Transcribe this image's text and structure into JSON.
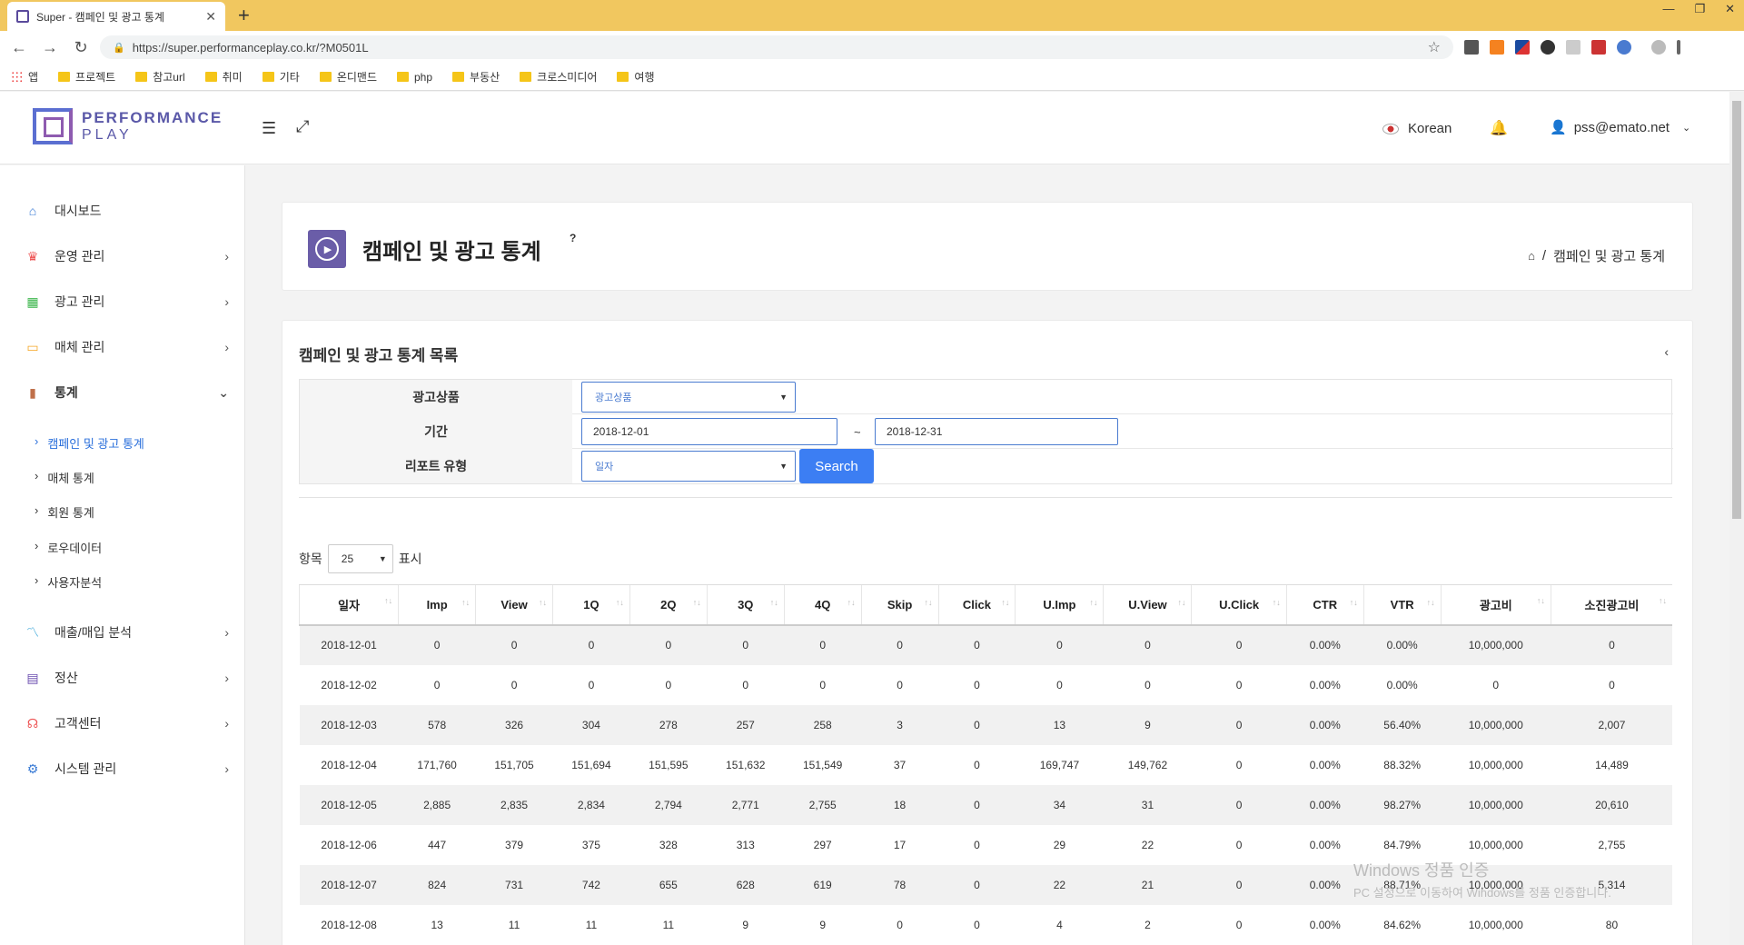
{
  "browser": {
    "tab_title": "Super - 캠페인 및 광고 통계",
    "url": "https://super.performanceplay.co.kr/?M0501L",
    "bookmarks": [
      "앱",
      "프로젝트",
      "참고url",
      "취미",
      "기타",
      "온디맨드",
      "php",
      "부동산",
      "크로스미디어",
      "여행"
    ]
  },
  "header": {
    "logo_line1": "PERFORMANCE",
    "logo_line2": "PLAY",
    "language": "Korean",
    "user_email": "pss@emato.net"
  },
  "sidebar": {
    "items": [
      {
        "label": "대시보드",
        "icon": "home-icon"
      },
      {
        "label": "운영 관리",
        "icon": "crown-icon"
      },
      {
        "label": "광고 관리",
        "icon": "grid-icon"
      },
      {
        "label": "매체 관리",
        "icon": "monitor-icon"
      },
      {
        "label": "통계",
        "icon": "bar-chart-icon"
      },
      {
        "label": "매출/매입 분석",
        "icon": "line-chart-icon"
      },
      {
        "label": "정산",
        "icon": "calculator-icon"
      },
      {
        "label": "고객센터",
        "icon": "headset-icon"
      },
      {
        "label": "시스템 관리",
        "icon": "gear-icon"
      }
    ],
    "sub_items": [
      "캠페인 및 광고 통계",
      "매체 통계",
      "회원 통계",
      "로우데이터",
      "사용자분석"
    ]
  },
  "page": {
    "title": "캠페인 및 광고 통계",
    "help": "?",
    "breadcrumb": "캠페인 및 광고 통계"
  },
  "list": {
    "title": "캠페인 및 광고 통계 목록",
    "filter": {
      "product_label": "광고상품",
      "product_value": "광고상품",
      "period_label": "기간",
      "date_from": "2018-12-01",
      "tilde": "~",
      "date_to": "2018-12-31",
      "report_label": "리포트 유형",
      "report_value": "일자",
      "search_label": "Search"
    },
    "page_length": {
      "prefix": "항목",
      "value": "25",
      "suffix": "표시"
    },
    "columns": [
      "일자",
      "Imp",
      "View",
      "1Q",
      "2Q",
      "3Q",
      "4Q",
      "Skip",
      "Click",
      "U.Imp",
      "U.View",
      "U.Click",
      "CTR",
      "VTR",
      "광고비",
      "소진광고비"
    ],
    "rows": [
      [
        "2018-12-01",
        "0",
        "0",
        "0",
        "0",
        "0",
        "0",
        "0",
        "0",
        "0",
        "0",
        "0",
        "0.00%",
        "0.00%",
        "10,000,000",
        "0"
      ],
      [
        "2018-12-02",
        "0",
        "0",
        "0",
        "0",
        "0",
        "0",
        "0",
        "0",
        "0",
        "0",
        "0",
        "0.00%",
        "0.00%",
        "0",
        "0"
      ],
      [
        "2018-12-03",
        "578",
        "326",
        "304",
        "278",
        "257",
        "258",
        "3",
        "0",
        "13",
        "9",
        "0",
        "0.00%",
        "56.40%",
        "10,000,000",
        "2,007"
      ],
      [
        "2018-12-04",
        "171,760",
        "151,705",
        "151,694",
        "151,595",
        "151,632",
        "151,549",
        "37",
        "0",
        "169,747",
        "149,762",
        "0",
        "0.00%",
        "88.32%",
        "10,000,000",
        "14,489"
      ],
      [
        "2018-12-05",
        "2,885",
        "2,835",
        "2,834",
        "2,794",
        "2,771",
        "2,755",
        "18",
        "0",
        "34",
        "31",
        "0",
        "0.00%",
        "98.27%",
        "10,000,000",
        "20,610"
      ],
      [
        "2018-12-06",
        "447",
        "379",
        "375",
        "328",
        "313",
        "297",
        "17",
        "0",
        "29",
        "22",
        "0",
        "0.00%",
        "84.79%",
        "10,000,000",
        "2,755"
      ],
      [
        "2018-12-07",
        "824",
        "731",
        "742",
        "655",
        "628",
        "619",
        "78",
        "0",
        "22",
        "21",
        "0",
        "0.00%",
        "88.71%",
        "10,000,000",
        "5,314"
      ],
      [
        "2018-12-08",
        "13",
        "11",
        "11",
        "11",
        "9",
        "9",
        "0",
        "0",
        "4",
        "2",
        "0",
        "0.00%",
        "84.62%",
        "10,000,000",
        "80"
      ]
    ]
  },
  "watermark": {
    "line1": "Windows 정품 인증",
    "line2": "PC 설정으로 이동하여 Windows를 정품 인증합니다."
  }
}
